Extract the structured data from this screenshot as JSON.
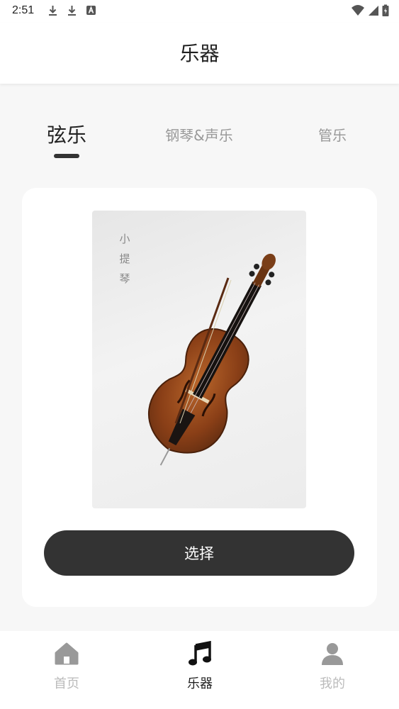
{
  "status_bar": {
    "time": "2:51",
    "left_icons": [
      "download-icon",
      "download-icon",
      "font-a-icon"
    ],
    "right_icons": [
      "wifi-icon",
      "signal-icon",
      "battery-icon"
    ]
  },
  "header": {
    "title": "乐器"
  },
  "tabs": [
    {
      "label": "弦乐",
      "active": true
    },
    {
      "label": "钢琴&声乐",
      "active": false
    },
    {
      "label": "管乐",
      "active": false
    }
  ],
  "card": {
    "image_caption_chars": [
      "小",
      "提",
      "琴"
    ],
    "image_icon": "cello-image",
    "select_label": "选择"
  },
  "bottom_nav": [
    {
      "label": "首页",
      "icon": "home-icon",
      "active": false
    },
    {
      "label": "乐器",
      "icon": "music-note-icon",
      "active": true
    },
    {
      "label": "我的",
      "icon": "person-icon",
      "active": false
    }
  ],
  "colors": {
    "accent": "#333333",
    "inactive": "#bbbbbb",
    "background": "#f7f7f7",
    "card": "#ffffff"
  }
}
